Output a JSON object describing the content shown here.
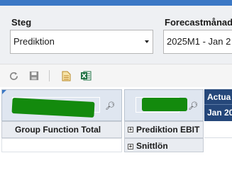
{
  "filters": {
    "steg": {
      "label": "Steg",
      "value": "Prediktion"
    },
    "forecast": {
      "label": "Forecastmånad",
      "value": "2025M1 - Jan 2"
    }
  },
  "toolbar": {
    "icons": [
      "refresh-icon",
      "save-icon",
      "document-icon",
      "excel-icon"
    ]
  },
  "grid": {
    "header": {
      "col1": "Actua",
      "col2": "Jan 20"
    },
    "rows": [
      {
        "label": "Group Function Total",
        "item": "Prediktion EBIT"
      },
      {
        "label": "",
        "item": "Snittlön"
      }
    ]
  }
}
